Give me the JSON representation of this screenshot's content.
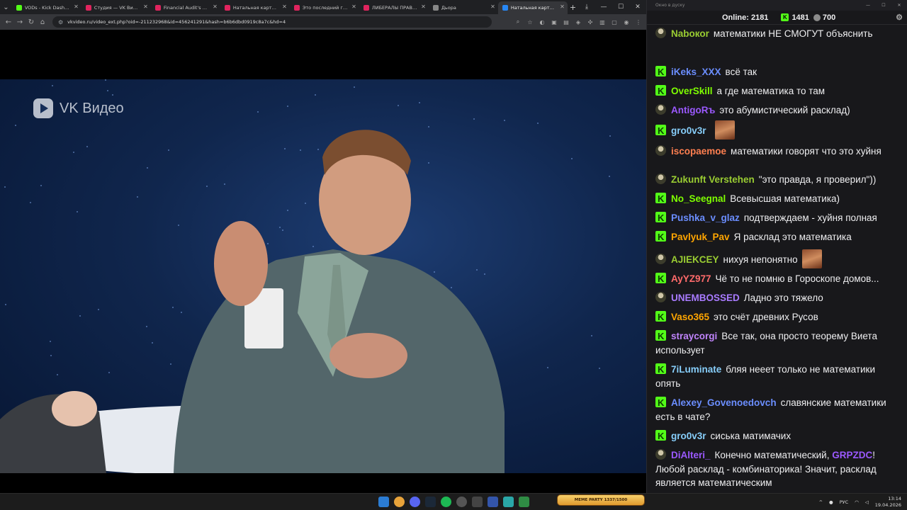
{
  "browser": {
    "tabs": [
      {
        "label": "VODs - Kick Dashboard",
        "color": "#53fc18"
      },
      {
        "label": "Студия — VK Видео Li…",
        "color": "#e0245e"
      },
      {
        "label": "Financial Audit's First F…",
        "color": "#e0245e"
      },
      {
        "label": "Натальная карта #58 …",
        "color": "#e0245e"
      },
      {
        "label": "Это последний год Пу…",
        "color": "#e0245e"
      },
      {
        "label": "ЛИБЕРАЛЫ ПРАВЫ В …",
        "color": "#e0245e"
      },
      {
        "label": "Дьора",
        "color": "#888888"
      },
      {
        "label": "Натальная карта #…",
        "color": "#2787f5"
      }
    ],
    "url": "vkvideo.ru/video_ext.php?oid=-211232968&id=456241291&hash=b6b6dbd0919c8a7c&hd=4"
  },
  "video": {
    "brand": "VK Видео"
  },
  "chat": {
    "window_title": "Окно в дуску",
    "online_label": "Online:",
    "online_count": "2181",
    "followers": "1481",
    "viewers": "700",
    "messages": [
      {
        "badge": "img",
        "user": "Naboкоr",
        "color": "#9acd32",
        "text": "математики НЕ СМОГУТ объяснить"
      },
      {
        "badge": "kick",
        "user": "iKeks_XXX",
        "color": "#6b8eff",
        "text": "всё так"
      },
      {
        "badge": "kick",
        "user": "OverSkill",
        "color": "#7fff00",
        "text": "а где математика то там"
      },
      {
        "badge": "img",
        "user": "AntigoRъ",
        "color": "#9b59ff",
        "text": "это абумистический расклад)"
      },
      {
        "badge": "kick",
        "user": "gro0v3r",
        "color": "#87cefa",
        "text": "",
        "emote": true
      },
      {
        "badge": "img",
        "user": "iscopaemoe",
        "color": "#ff7f50",
        "text": "математики говорят что это хуйня"
      },
      {
        "badge": "img",
        "user": "Zukunft Verstehen",
        "color": "#9acd32",
        "text": "\"это правда, я проверил\"))"
      },
      {
        "badge": "kick",
        "user": "No_Seegnal",
        "color": "#7fff00",
        "text": "Всевысшая математика)"
      },
      {
        "badge": "kick",
        "user": "Pushka_v_glaz",
        "color": "#6b8eff",
        "text": "подтверждаем - хуйня полная"
      },
      {
        "badge": "kick",
        "user": "Pavlyuk_Pav",
        "color": "#ffa500",
        "text": "Я расклад это математика"
      },
      {
        "badge": "img",
        "user": "AJIEKCEY",
        "color": "#9acd32",
        "text": "нихуя непонятно",
        "emote": true
      },
      {
        "badge": "kick",
        "user": "AyYZ977",
        "color": "#ff6b6b",
        "text": "Чё то не помню в Гороскопе домов..."
      },
      {
        "badge": "img",
        "user": "UNEMBOSSED",
        "color": "#a97bff",
        "text": "Ладно это тяжело"
      },
      {
        "badge": "kick",
        "user": "Vaso365",
        "color": "#ffa500",
        "text": "это счёт древних Русов"
      },
      {
        "badge": "kick",
        "user": "straycorgi",
        "color": "#c084fc",
        "text": "Все так, она просто теорему Виета использует"
      },
      {
        "badge": "kick",
        "user": "7iLuminate",
        "color": "#87cefa",
        "text": "бляя нееет только не математики опять"
      },
      {
        "badge": "kick",
        "user": "Alexey_Govenoedovch",
        "color": "#6b8eff",
        "text": "славянские математики есть в чате?"
      },
      {
        "badge": "kick",
        "user": "gro0v3r",
        "color": "#87cefa",
        "text": "сиська матимачих"
      },
      {
        "badge": "img",
        "user": "DiAlteri_",
        "color": "#9b59ff",
        "text": "Конечно математический,",
        "mention": "GRPZDC",
        "mention_color": "#9b59ff",
        "text2": "! Любой расклад - комбинаторика! Значит, расклад является математическим"
      }
    ]
  },
  "taskbar": {
    "meme_widget": "MEME PARTY 1337/1500",
    "lang": "РУС",
    "time": "13:14",
    "date": "19.04.2026"
  }
}
